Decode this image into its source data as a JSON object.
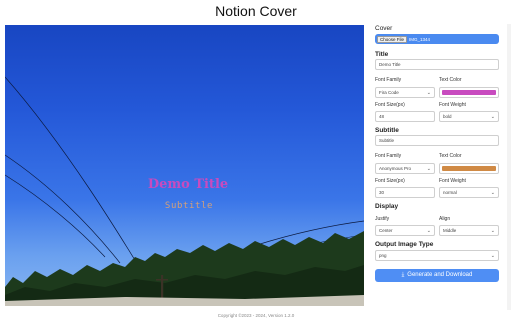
{
  "app": {
    "title": "Notion Cover"
  },
  "preview": {
    "title": "Demo Title",
    "title_color": "#c84bbf",
    "subtitle": "Subtitle",
    "subtitle_color": "#d4a07a"
  },
  "panel": {
    "cover": {
      "label": "Cover",
      "button": "Choose File",
      "file_name": "IMG_1344"
    },
    "title": {
      "label": "Title",
      "value": "Demo Title",
      "font_family_label": "Font Family",
      "font_family": "Fira Code",
      "text_color_label": "Text Color",
      "text_color": "#c84bbf",
      "font_size_label": "Font Size(px)",
      "font_size": "48",
      "font_weight_label": "Font Weight",
      "font_weight": "bold"
    },
    "subtitle": {
      "label": "Subtitle",
      "value": "Subtitle",
      "font_family_label": "Font Family",
      "font_family": "Anonymous Pro",
      "text_color_label": "Text Color",
      "text_color": "#d08a45",
      "font_size_label": "Font Size(px)",
      "font_size": "30",
      "font_weight_label": "Font Weight",
      "font_weight": "normal"
    },
    "display": {
      "label": "Display",
      "justify_label": "Justify",
      "justify": "Center",
      "align_label": "Align",
      "align": "Middle"
    },
    "output": {
      "label": "Output Image Type",
      "type": "png"
    },
    "generate_button": "Generate and Download"
  },
  "footer": {
    "text": "Copyright ©2023 - 2024, Version 1.2.0"
  }
}
